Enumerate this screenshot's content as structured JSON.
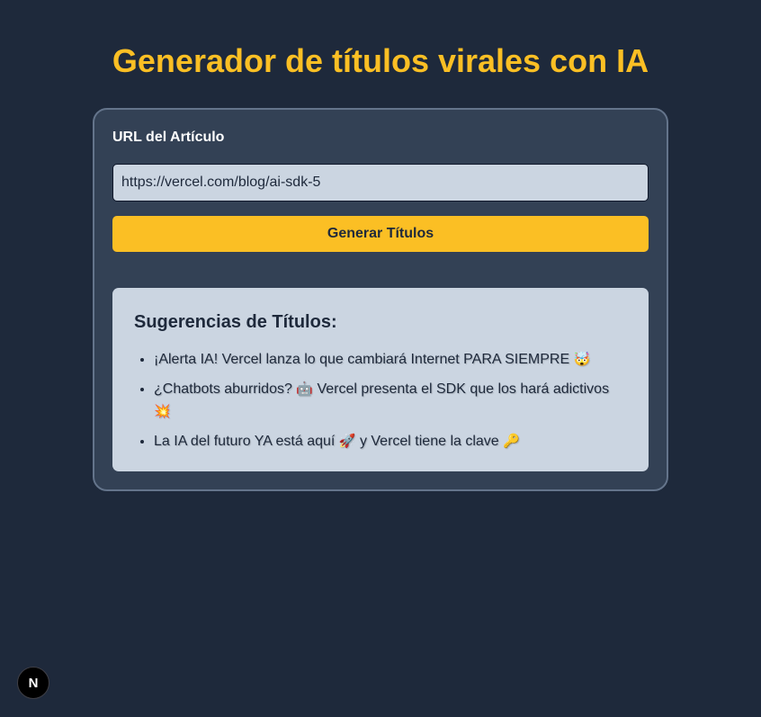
{
  "header": {
    "title": "Generador de títulos virales con IA"
  },
  "form": {
    "url_label": "URL del Artículo",
    "url_value": "https://vercel.com/blog/ai-sdk-5",
    "generate_button": "Generar Títulos"
  },
  "results": {
    "heading": "Sugerencias de Títulos:",
    "items": [
      {
        "text": "¡Alerta IA! Vercel lanza lo que cambiará Internet PARA SIEMPRE",
        "emoji": "🤯"
      },
      {
        "text_before": "¿Chatbots aburridos?",
        "emoji_mid": "🤖",
        "text_after": "Vercel presenta el SDK que los hará adictivos",
        "emoji_end": "💥"
      },
      {
        "text_before": "La IA del futuro YA está aquí",
        "emoji_mid": "🚀",
        "text_after": "y Vercel tiene la clave",
        "emoji_end": "🔑"
      }
    ]
  },
  "dev_badge": {
    "label": "N",
    "icon": "nextjs-logo-icon"
  },
  "colors": {
    "background": "#1e293b",
    "accent": "#fbbf24",
    "card": "#334155",
    "panel": "#cbd5e1"
  }
}
